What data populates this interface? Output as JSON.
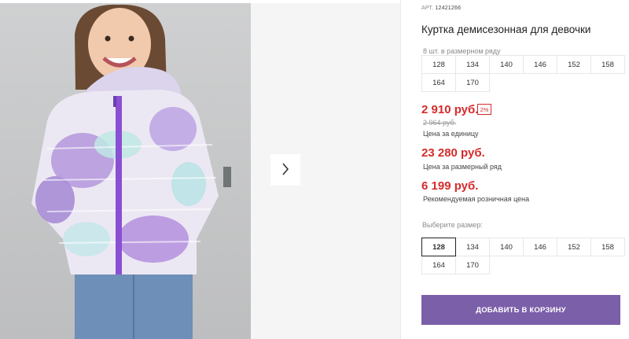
{
  "product": {
    "article_label": "АРТ.",
    "article_number": "12421266",
    "title": "Куртка демисезонная для девочки"
  },
  "pack": {
    "label": "8 шт. в размерном ряду",
    "sizes": [
      "128",
      "134",
      "140",
      "146",
      "152",
      "158",
      "164",
      "170"
    ]
  },
  "pricing": {
    "unit_price": "2 910 руб.",
    "discount_badge": "2%",
    "old_price": "2 964 руб.",
    "unit_caption": "Цена за единицу",
    "pack_price": "23 280 руб.",
    "pack_caption": "Цена за размерный ряд",
    "retail_price": "6 199 руб.",
    "retail_caption": "Рекомендуемая розничная цена"
  },
  "size_select": {
    "label": "Выберите размер:",
    "sizes": [
      "128",
      "134",
      "140",
      "146",
      "152",
      "158",
      "164",
      "170"
    ],
    "selected": "128"
  },
  "cart": {
    "button_label": "ДОБАВИТЬ В КОРЗИНУ"
  },
  "gallery": {
    "next_icon": "chevron-right-icon"
  },
  "colors": {
    "accent": "#7b5fa9",
    "price": "#d52b2b"
  }
}
